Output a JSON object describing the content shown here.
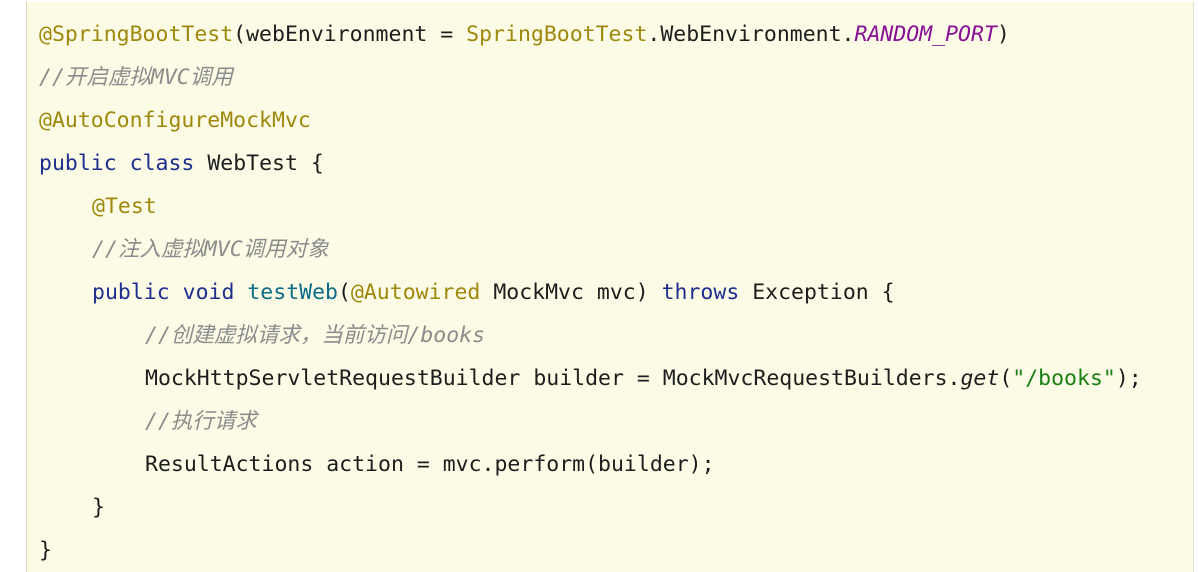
{
  "code": {
    "line1": {
      "ann": "@SpringBootTest",
      "open": "(webEnvironment = ",
      "ann_class": "SpringBootTest",
      "mid": ".WebEnvironment.",
      "enum": "RANDOM_PORT",
      "close": ")"
    },
    "line2": {
      "comment": "//开启虚拟MVC调用"
    },
    "line3": {
      "ann": "@AutoConfigureMockMvc"
    },
    "line4": {
      "kw1": "public",
      "kw2": "class",
      "name": "WebTest",
      "brace": "{"
    },
    "line5": {
      "ann": "@Test"
    },
    "line6": {
      "comment": "//注入虚拟MVC调用对象"
    },
    "line7": {
      "kw1": "public",
      "kw2": "void",
      "method": "testWeb",
      "paren_open": "(",
      "ann": "@Autowired",
      "param": " MockMvc mvc) ",
      "kw3": "throws",
      "rest": " Exception {"
    },
    "line8": {
      "comment": "//创建虚拟请求，当前访问/books"
    },
    "line9": {
      "decl": "MockHttpServletRequestBuilder builder = MockMvcRequestBuilders.",
      "method": "get",
      "paren_open": "(",
      "string": "\"/books\"",
      "end": ");"
    },
    "line10": {
      "comment": "//执行请求"
    },
    "line11": {
      "text": "ResultActions action = mvc.perform(builder);"
    },
    "line12": {
      "text": "}"
    },
    "line13": {
      "text": "}"
    }
  }
}
